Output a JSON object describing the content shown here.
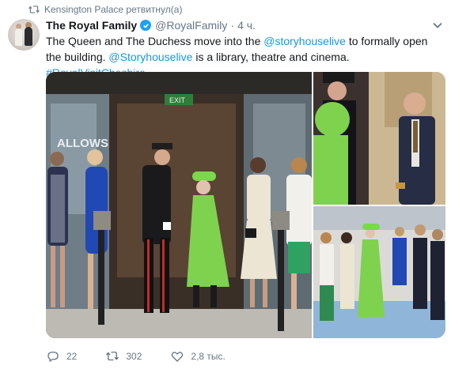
{
  "retweet": {
    "icon": "retweet-icon",
    "text": "Kensington Palace ретвитнул(а)"
  },
  "tweet": {
    "author_name": "The Royal Family",
    "handle": "@RoyalFamily",
    "separator": "·",
    "time": "4 ч.",
    "verified": true,
    "text_parts": {
      "p1": "The Queen and The Duchess move into the ",
      "link1": "@storyhouselive",
      "p2": " to formally open the building. ",
      "link2": "@Storyhouselive",
      "p3": " is a library, theatre and cinema. ",
      "link3": "#RoyalVisitCheshire"
    },
    "link_color": "#1b95e0"
  },
  "media": {
    "sign_text": "ALLOWS",
    "exit_sign": "EXIT"
  },
  "actions": {
    "reply_count": "22",
    "retweet_count": "302",
    "like_count": "2,8 тыс."
  }
}
